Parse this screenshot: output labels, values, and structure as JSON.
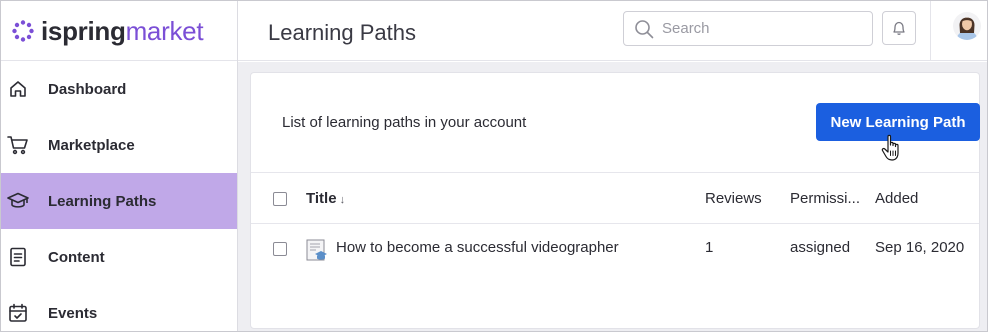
{
  "logo": {
    "word1": "ispring",
    "word2": "market"
  },
  "sidebar": {
    "items": [
      {
        "label": "Dashboard",
        "icon": "home-icon",
        "active": false
      },
      {
        "label": "Marketplace",
        "icon": "cart-icon",
        "active": false
      },
      {
        "label": "Learning Paths",
        "icon": "graduation-cap-icon",
        "active": true
      },
      {
        "label": "Content",
        "icon": "document-icon",
        "active": false
      },
      {
        "label": "Events",
        "icon": "calendar-icon",
        "active": false
      }
    ]
  },
  "header": {
    "title": "Learning Paths",
    "search": {
      "placeholder": "Search",
      "value": ""
    },
    "bell_icon": "bell-icon",
    "avatar": "user-avatar"
  },
  "main": {
    "description": "List of learning paths in your account",
    "new_button_label": "New Learning Path",
    "table": {
      "columns": [
        "Title",
        "Reviews",
        "Permissi...",
        "Added"
      ],
      "sort_indicator": "↓",
      "rows": [
        {
          "title": "How to become a successful videographer",
          "reviews": "1",
          "permission": "assigned",
          "added": "Sep 16, 2020"
        }
      ]
    }
  },
  "colors": {
    "accent": "#1b5fe0",
    "brand": "#7b4fd6",
    "active_nav": "#c0a8e8",
    "background": "#eeeef2"
  }
}
